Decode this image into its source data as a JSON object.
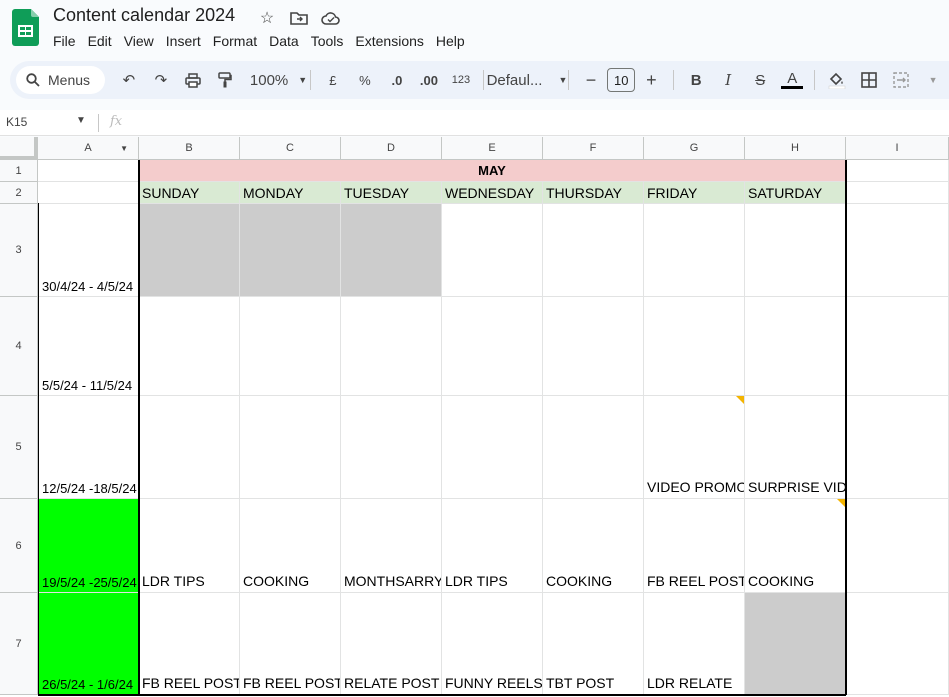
{
  "app": {
    "title": "Content calendar 2024",
    "menu": [
      "File",
      "Edit",
      "View",
      "Insert",
      "Format",
      "Data",
      "Tools",
      "Extensions",
      "Help"
    ]
  },
  "toolbar": {
    "search_label": "Menus",
    "zoom": "100%",
    "currency": "£",
    "percent": "%",
    "decimal_decrease": ".0",
    "decimal_increase": ".00",
    "number_format": "123",
    "font_family": "Defaul...",
    "font_size": "10",
    "bold": "B",
    "italic": "I",
    "text_color_label": "A"
  },
  "formula_bar": {
    "cell_ref": "K15",
    "fx": "fx"
  },
  "sheet": {
    "columns": [
      "A",
      "B",
      "C",
      "D",
      "E",
      "F",
      "G",
      "H",
      "I"
    ],
    "rows": [
      "1",
      "2",
      "3",
      "4",
      "5",
      "6",
      "7"
    ],
    "month": "MAY",
    "days": [
      "SUNDAY",
      "MONDAY",
      "TUESDAY",
      "WEDNESDAY",
      "THURSDAY",
      "FRIDAY",
      "SATURDAY"
    ],
    "weeks": [
      {
        "range": "30/4/24 - 4/5/24",
        "cells": [
          "",
          "",
          "",
          "",
          "",
          "",
          ""
        ]
      },
      {
        "range": "5/5/24 - 11/5/24",
        "cells": [
          "",
          "",
          "",
          "",
          "",
          "",
          ""
        ]
      },
      {
        "range": "12/5/24 -18/5/24",
        "cells": [
          "",
          "",
          "",
          "",
          "",
          "VIDEO PROMO",
          "SURPRISE VID"
        ]
      },
      {
        "range": "19/5/24 -25/5/24",
        "cells": [
          "LDR TIPS",
          "COOKING",
          "MONTHSARRY",
          "LDR TIPS",
          "COOKING",
          "FB REEL POST",
          "COOKING"
        ]
      },
      {
        "range": "26/5/24 - 1/6/24",
        "cells": [
          "FB REEL POST",
          "FB REEL POST",
          "RELATE POST",
          "FUNNY REELS",
          "TBT POST",
          "LDR RELATE",
          ""
        ]
      }
    ],
    "colors": {
      "month_bg": "#f4cccc",
      "days_bg": "#d9ead3",
      "greyed": "#cccccc",
      "highlight": "#00ff00",
      "note": "#f4b400"
    }
  }
}
